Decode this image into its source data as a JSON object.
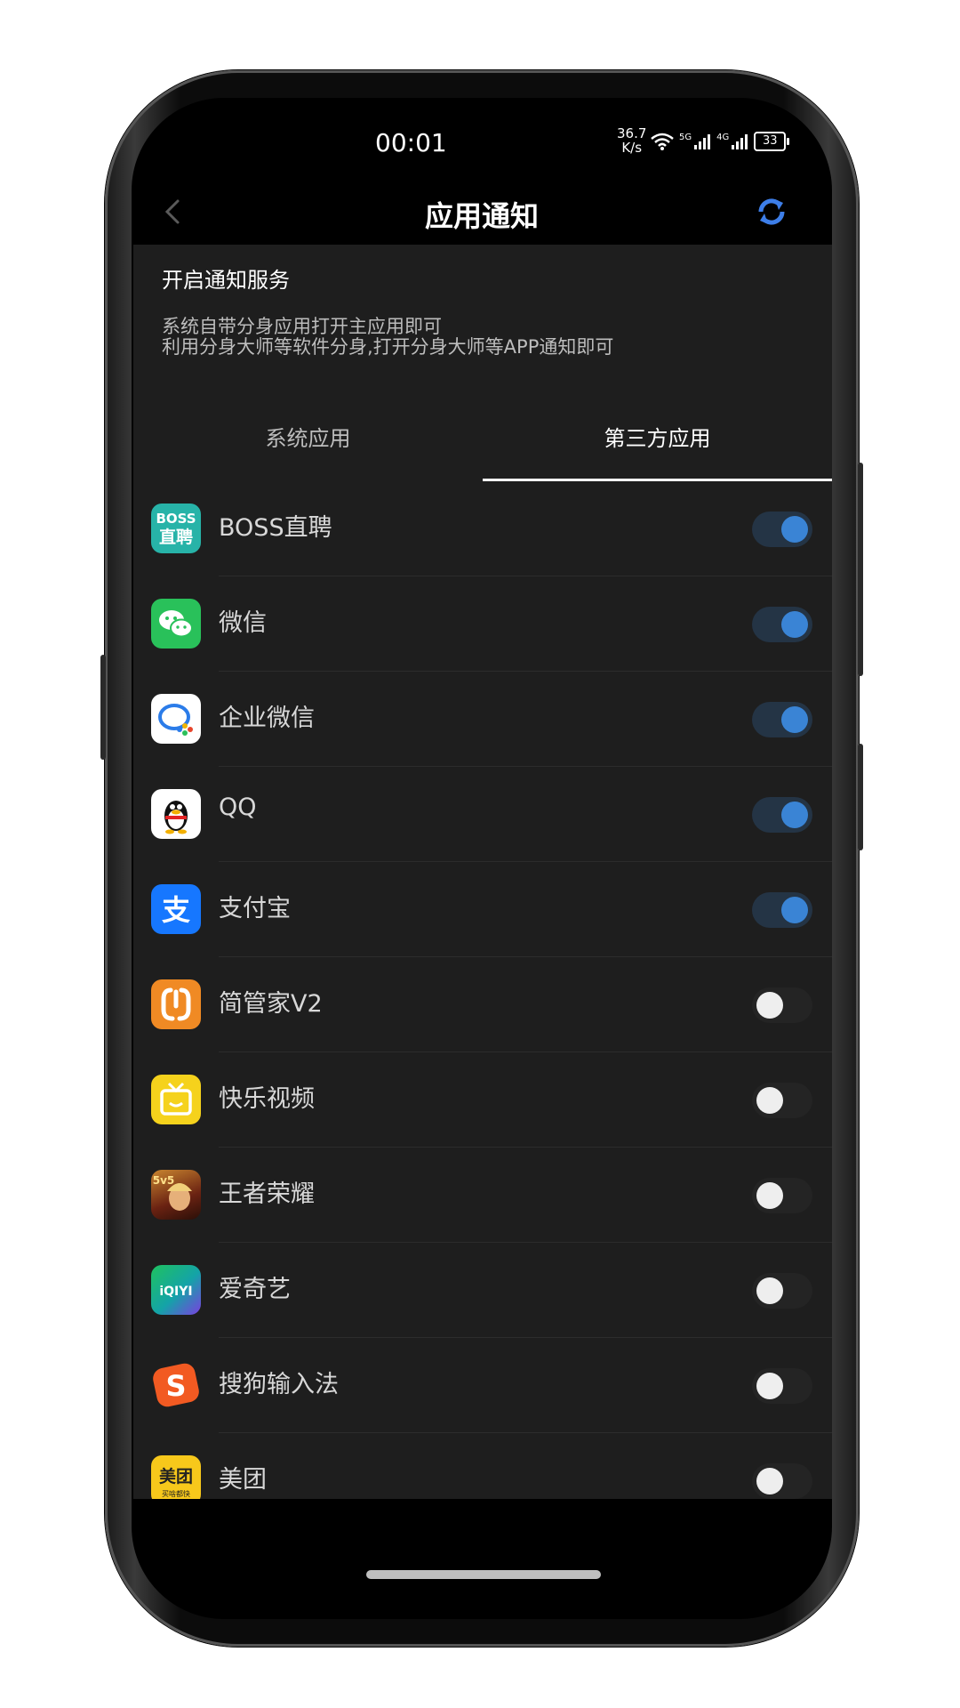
{
  "status_bar": {
    "time": "00:01",
    "net_speed_value": "36.7",
    "net_speed_unit": "K/s",
    "signal1_label": "5G",
    "signal2_label": "4G",
    "battery": "33"
  },
  "header": {
    "title": "应用通知",
    "back_icon": "chevron-left-icon",
    "refresh_icon": "sync-icon"
  },
  "notice": {
    "title": "开启通知服务",
    "line1": "系统自带分身应用打开主应用即可",
    "line2": "利用分身大师等软件分身,打开分身大师等APP通知即可"
  },
  "tabs": [
    {
      "label": "系统应用",
      "selected": false
    },
    {
      "label": "第三方应用",
      "selected": true
    }
  ],
  "apps": [
    {
      "name": "BOSS直聘",
      "enabled": true,
      "icon_text_top": "BOSS",
      "icon_text_bottom": "直聘"
    },
    {
      "name": "微信",
      "enabled": true
    },
    {
      "name": "企业微信",
      "enabled": true
    },
    {
      "name": "QQ",
      "enabled": true
    },
    {
      "name": "支付宝",
      "enabled": true,
      "icon_text": "支"
    },
    {
      "name": "简管家V2",
      "enabled": false
    },
    {
      "name": "快乐视频",
      "enabled": false
    },
    {
      "name": "王者荣耀",
      "enabled": false,
      "icon_text": "5v5"
    },
    {
      "name": "爱奇艺",
      "enabled": false,
      "icon_text": "iQIYI"
    },
    {
      "name": "搜狗输入法",
      "enabled": false,
      "icon_text": "S"
    },
    {
      "name": "美团",
      "enabled": false,
      "icon_text_top": "美团",
      "icon_text_bottom": "买啥都快"
    },
    {
      "name": "",
      "enabled": false
    }
  ],
  "colors": {
    "switch_on_knob": "#3a84d5",
    "switch_on_track": "#243445",
    "switch_off_knob": "#eeeeee",
    "row_background": "#1e1e1e",
    "screen_background": "#000000"
  }
}
